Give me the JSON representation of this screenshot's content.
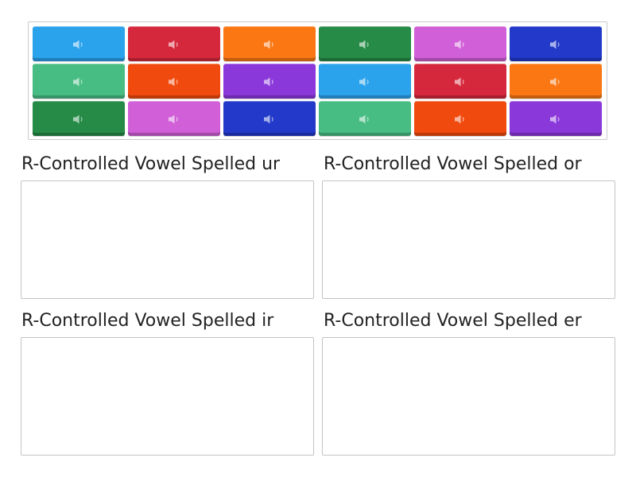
{
  "tiles": [
    {
      "color": "#2ba2ec",
      "icon": "speaker-icon"
    },
    {
      "color": "#d6283c",
      "icon": "speaker-icon"
    },
    {
      "color": "#fa7714",
      "icon": "speaker-icon"
    },
    {
      "color": "#268b47",
      "icon": "speaker-icon"
    },
    {
      "color": "#d15fd7",
      "icon": "speaker-icon"
    },
    {
      "color": "#2239c9",
      "icon": "speaker-icon"
    },
    {
      "color": "#48bd83",
      "icon": "speaker-icon"
    },
    {
      "color": "#f14a0e",
      "icon": "speaker-icon"
    },
    {
      "color": "#8b38db",
      "icon": "speaker-icon"
    },
    {
      "color": "#2ba2ec",
      "icon": "speaker-icon"
    },
    {
      "color": "#d6283c",
      "icon": "speaker-icon"
    },
    {
      "color": "#fa7714",
      "icon": "speaker-icon"
    },
    {
      "color": "#268b47",
      "icon": "speaker-icon"
    },
    {
      "color": "#d15fd7",
      "icon": "speaker-icon"
    },
    {
      "color": "#2239c9",
      "icon": "speaker-icon"
    },
    {
      "color": "#48bd83",
      "icon": "speaker-icon"
    },
    {
      "color": "#f14a0e",
      "icon": "speaker-icon"
    },
    {
      "color": "#8b38db",
      "icon": "speaker-icon"
    }
  ],
  "groups": [
    {
      "title": "R-Controlled Vowel Spelled ur"
    },
    {
      "title": "R-Controlled Vowel Spelled or"
    },
    {
      "title": "R-Controlled Vowel Spelled ir"
    },
    {
      "title": "R-Controlled Vowel Spelled er"
    }
  ]
}
